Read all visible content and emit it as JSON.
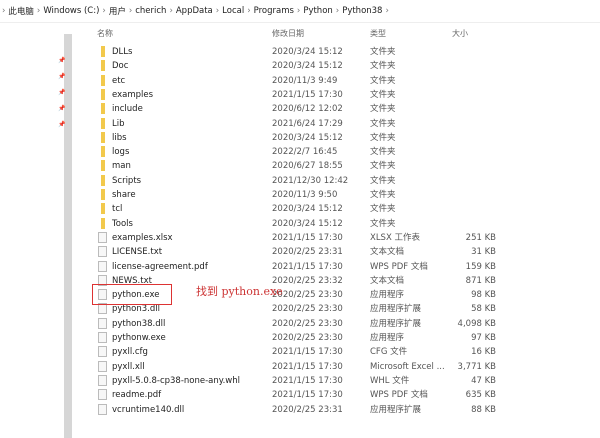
{
  "breadcrumb": [
    "此电脑",
    "Windows (C:)",
    "用户",
    "cherich",
    "AppData",
    "Local",
    "Programs",
    "Python",
    "Python38"
  ],
  "columns": {
    "name": "名称",
    "date": "修改日期",
    "type": "类型",
    "size": "大小"
  },
  "files": [
    {
      "name": "DLLs",
      "date": "2020/3/24 15:12",
      "type": "文件夹",
      "size": "",
      "icon": "folder"
    },
    {
      "name": "Doc",
      "date": "2020/3/24 15:12",
      "type": "文件夹",
      "size": "",
      "icon": "folder"
    },
    {
      "name": "etc",
      "date": "2020/11/3 9:49",
      "type": "文件夹",
      "size": "",
      "icon": "folder"
    },
    {
      "name": "examples",
      "date": "2021/1/15 17:30",
      "type": "文件夹",
      "size": "",
      "icon": "folder"
    },
    {
      "name": "include",
      "date": "2020/6/12 12:02",
      "type": "文件夹",
      "size": "",
      "icon": "folder"
    },
    {
      "name": "Lib",
      "date": "2021/6/24 17:29",
      "type": "文件夹",
      "size": "",
      "icon": "folder"
    },
    {
      "name": "libs",
      "date": "2020/3/24 15:12",
      "type": "文件夹",
      "size": "",
      "icon": "folder"
    },
    {
      "name": "logs",
      "date": "2022/2/7 16:45",
      "type": "文件夹",
      "size": "",
      "icon": "folder"
    },
    {
      "name": "man",
      "date": "2020/6/27 18:55",
      "type": "文件夹",
      "size": "",
      "icon": "folder"
    },
    {
      "name": "Scripts",
      "date": "2021/12/30 12:42",
      "type": "文件夹",
      "size": "",
      "icon": "folder"
    },
    {
      "name": "share",
      "date": "2020/11/3 9:50",
      "type": "文件夹",
      "size": "",
      "icon": "folder"
    },
    {
      "name": "tcl",
      "date": "2020/3/24 15:12",
      "type": "文件夹",
      "size": "",
      "icon": "folder"
    },
    {
      "name": "Tools",
      "date": "2020/3/24 15:12",
      "type": "文件夹",
      "size": "",
      "icon": "folder"
    },
    {
      "name": "examples.xlsx",
      "date": "2021/1/15 17:30",
      "type": "XLSX 工作表",
      "size": "251 KB",
      "icon": "file"
    },
    {
      "name": "LICENSE.txt",
      "date": "2020/2/25 23:31",
      "type": "文本文档",
      "size": "31 KB",
      "icon": "file"
    },
    {
      "name": "license-agreement.pdf",
      "date": "2021/1/15 17:30",
      "type": "WPS PDF 文档",
      "size": "159 KB",
      "icon": "file"
    },
    {
      "name": "NEWS.txt",
      "date": "2020/2/25 23:32",
      "type": "文本文档",
      "size": "871 KB",
      "icon": "file"
    },
    {
      "name": "python.exe",
      "date": "2020/2/25 23:30",
      "type": "应用程序",
      "size": "98 KB",
      "icon": "file"
    },
    {
      "name": "python3.dll",
      "date": "2020/2/25 23:30",
      "type": "应用程序扩展",
      "size": "58 KB",
      "icon": "file"
    },
    {
      "name": "python38.dll",
      "date": "2020/2/25 23:30",
      "type": "应用程序扩展",
      "size": "4,098 KB",
      "icon": "file"
    },
    {
      "name": "pythonw.exe",
      "date": "2020/2/25 23:30",
      "type": "应用程序",
      "size": "97 KB",
      "icon": "file"
    },
    {
      "name": "pyxll.cfg",
      "date": "2021/1/15 17:30",
      "type": "CFG 文件",
      "size": "16 KB",
      "icon": "file"
    },
    {
      "name": "pyxll.xll",
      "date": "2021/1/15 17:30",
      "type": "Microsoft Excel ...",
      "size": "3,771 KB",
      "icon": "file"
    },
    {
      "name": "pyxll-5.0.8-cp38-none-any.whl",
      "date": "2021/1/15 17:30",
      "type": "WHL 文件",
      "size": "47 KB",
      "icon": "file"
    },
    {
      "name": "readme.pdf",
      "date": "2021/1/15 17:30",
      "type": "WPS PDF 文档",
      "size": "635 KB",
      "icon": "file"
    },
    {
      "name": "vcruntime140.dll",
      "date": "2020/2/25 23:31",
      "type": "应用程序扩展",
      "size": "88 KB",
      "icon": "file"
    }
  ],
  "annotation": "找到 python.exe"
}
